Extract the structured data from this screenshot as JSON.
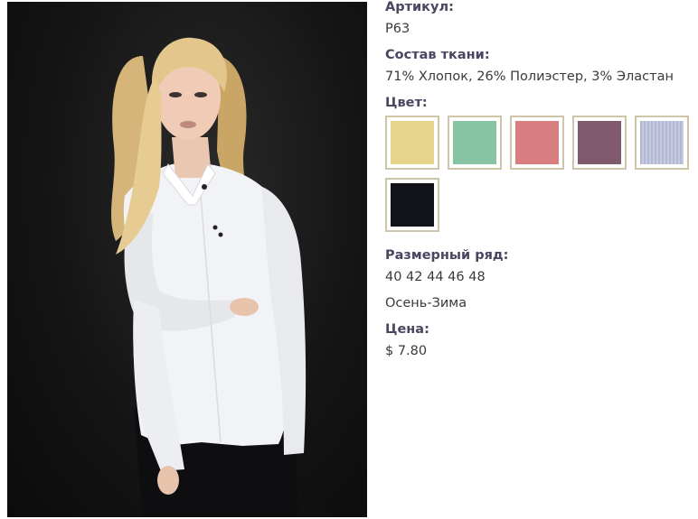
{
  "product": {
    "photo_alt": "model-in-white-shirt",
    "article_label": "Артикул:",
    "article_value": "P63",
    "fabric_label": "Состав ткани:",
    "fabric_value": "71% Хлопок, 26% Полиэстер, 3% Эластан",
    "color_label": "Цвет:",
    "colors": [
      {
        "name": "yellow",
        "hex": "#e8d58c"
      },
      {
        "name": "mint",
        "hex": "#86c4a4"
      },
      {
        "name": "coral",
        "hex": "#d97e80"
      },
      {
        "name": "mauve",
        "hex": "#7e5a6c"
      },
      {
        "name": "lavender-stripe",
        "hex": "#b3b8d2"
      },
      {
        "name": "black",
        "hex": "#111318"
      }
    ],
    "size_label": "Размерный ряд:",
    "size_value": "40 42 44 46 48",
    "season_value": "Осень-Зима",
    "price_label": "Цена:",
    "price_value": "$ 7.80"
  }
}
